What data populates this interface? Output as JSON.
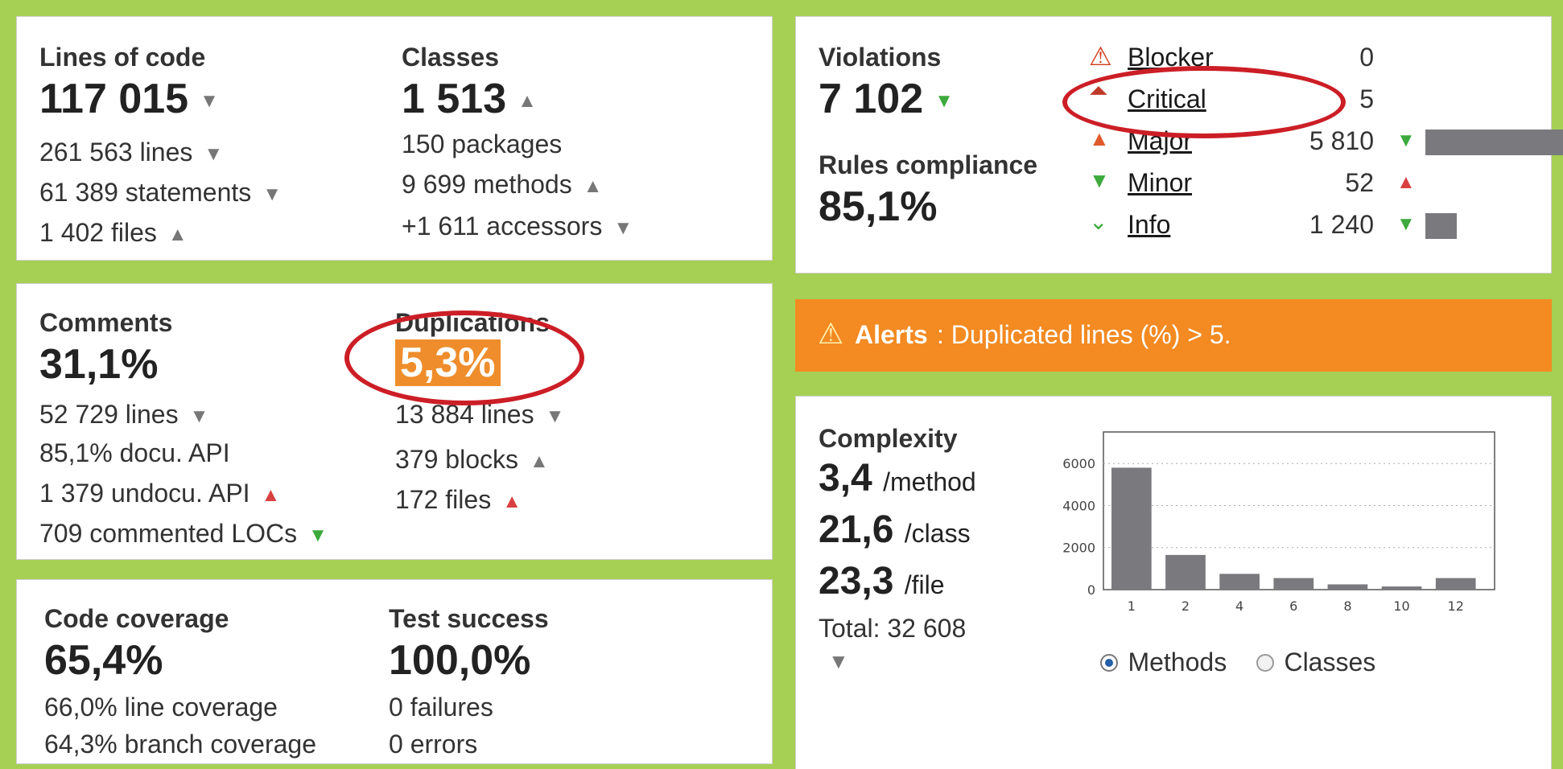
{
  "size": {
    "label": "Lines of code",
    "value": "117 015",
    "lines": "261 563 lines",
    "statements": "61 389 statements",
    "files": "1 402 files"
  },
  "classes": {
    "label": "Classes",
    "value": "1 513",
    "packages": "150 packages",
    "methods": "9 699 methods",
    "accessors": "+1 611 accessors"
  },
  "comments": {
    "label": "Comments",
    "value": "31,1%",
    "lines": "52 729 lines",
    "docu_api": "85,1% docu. API",
    "undocu_api": "1 379 undocu. API",
    "commented_locs": "709 commented LOCs"
  },
  "duplications": {
    "label": "Duplications",
    "value": "5,3%",
    "lines": "13 884 lines",
    "blocks": "379 blocks",
    "files": "172 files"
  },
  "coverage": {
    "label": "Code coverage",
    "value": "65,4%",
    "line_coverage": "66,0% line coverage",
    "branch_coverage": "64,3% branch coverage"
  },
  "tests": {
    "label": "Test success",
    "value": "100,0%",
    "failures": "0 failures",
    "errors": "0 errors"
  },
  "violations": {
    "label": "Violations",
    "value": "7 102",
    "compliance_label": "Rules compliance",
    "compliance_value": "85,1%",
    "severities": [
      {
        "name": "Blocker",
        "count": "0",
        "icon": "blocker-icon",
        "bar": 0
      },
      {
        "name": "Critical",
        "count": "5",
        "icon": "critical-icon",
        "bar": 0
      },
      {
        "name": "Major",
        "count": "5 810",
        "icon": "major-icon",
        "bar": 1.0
      },
      {
        "name": "Minor",
        "count": "52",
        "icon": "minor-icon",
        "bar": 0
      },
      {
        "name": "Info",
        "count": "1 240",
        "icon": "info-icon",
        "bar": 0.21
      }
    ]
  },
  "alert": {
    "title": "Alerts",
    "message": ": Duplicated lines (%) > 5."
  },
  "complexity": {
    "label": "Complexity",
    "per_method": "3,4",
    "per_method_unit": "/method",
    "per_class": "21,6",
    "per_class_unit": "/class",
    "per_file": "23,3",
    "per_file_unit": "/file",
    "total": "Total: 32 608",
    "radio_methods": "Methods",
    "radio_classes": "Classes"
  },
  "chart_data": {
    "type": "bar",
    "categories": [
      "1",
      "2",
      "4",
      "6",
      "8",
      "10",
      "12"
    ],
    "values": [
      5800,
      1650,
      750,
      550,
      250,
      150,
      550
    ],
    "yticks": [
      0,
      2000,
      4000,
      6000
    ],
    "ylim": [
      0,
      7500
    ],
    "grid": true,
    "bar_color": "#7a7a7e"
  }
}
